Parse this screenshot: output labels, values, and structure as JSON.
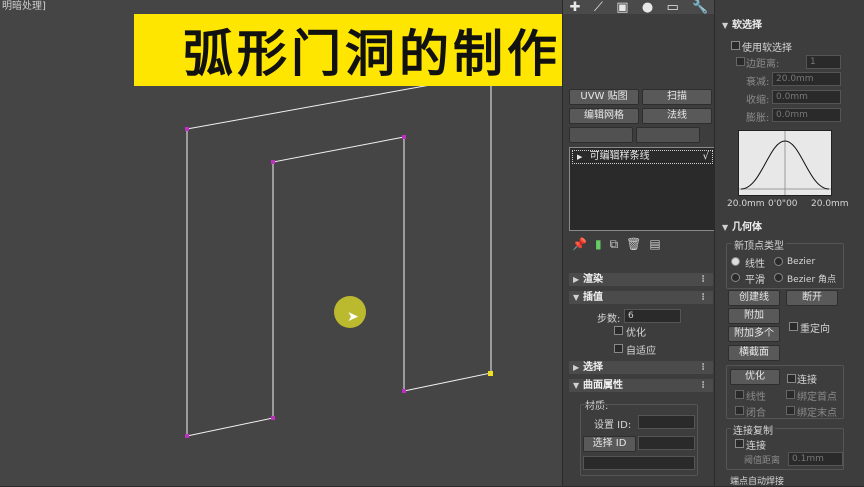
{
  "viewport": {
    "label": "明暗处理]",
    "title": "弧形门洞的制作方法"
  },
  "command_panel": {
    "tab_icons": [
      "plus-icon",
      "motion-curve-icon",
      "hierarchy-icon",
      "display-sphere-icon",
      "utility-icon",
      "wrench-icon"
    ],
    "buttons": {
      "uvw": "UVW 贴图",
      "sweep": "扫描",
      "edit_mesh": "编辑网格",
      "lathe": "法线"
    },
    "stack": {
      "item": "可编辑样条线"
    },
    "rollouts": {
      "render": "渲染",
      "interpolation": "插值",
      "selection": "选择",
      "surface": "曲面属性"
    },
    "interpolation": {
      "steps_label": "步数:",
      "steps_value": "6",
      "optimize": "优化",
      "adaptive": "自适应"
    },
    "surface": {
      "material_label": "材质:",
      "set_id": "设置 ID:",
      "select_id": "选择 ID"
    }
  },
  "soft_selection": {
    "title": "软选择",
    "use_soft": "使用软选择",
    "edge_distance": "边距离:",
    "edge_value": "1",
    "falloff_label": "衰减:",
    "falloff_value": "20.0mm",
    "pinch_label": "收缩:",
    "pinch_value": "0.0mm",
    "bubble_label": "膨胀:",
    "bubble_value": "0.0mm",
    "graph_left": "20.0mm",
    "graph_mid": "0'0\"00",
    "graph_right": "20.0mm"
  },
  "geometry": {
    "title": "几何体",
    "new_vertex_type": "新顶点类型",
    "linear": "线性",
    "bezier": "Bezier",
    "smooth": "平滑",
    "bezier_corner": "Bezier 角点",
    "create_line": "创建线",
    "break": "断开",
    "attach": "附加",
    "attach_multi": "附加多个",
    "reorient": "重定向",
    "cross_section": "横截面",
    "refine": "优化",
    "connect": "连接",
    "linear2": "线性",
    "bind_first": "绑定首点",
    "closed": "闭合",
    "bind_last": "绑定末点",
    "connect_copy": "连接复制",
    "connect2": "连接",
    "threshold": "阈值距离",
    "threshold_value": "0.1mm",
    "auto_weld": "端点自动焊接"
  }
}
